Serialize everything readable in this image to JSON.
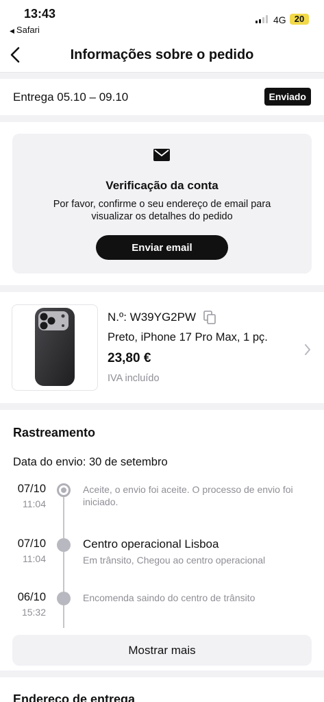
{
  "status_bar": {
    "time": "13:43",
    "back_app": "Safari",
    "network": "4G",
    "battery": "20"
  },
  "header": {
    "title": "Informações sobre o pedido"
  },
  "delivery": {
    "text": "Entrega 05.10 – 09.10",
    "status_badge": "Enviado"
  },
  "verification": {
    "icon": "mail-icon",
    "title": "Verificação da conta",
    "description": "Por favor, confirme o seu endereço de email para visualizar os detalhes do pedido",
    "button_label": "Enviar email"
  },
  "product": {
    "order_number": "N.º: W39YG2PW",
    "variant": "Preto, iPhone 17 Pro Max, 1 pç.",
    "price": "23,80 €",
    "tax_note": "IVA incluído"
  },
  "tracking": {
    "title": "Rastreamento",
    "ship_date": "Data do envio: 30 de setembro",
    "events": [
      {
        "date": "07/10",
        "time": "11:04",
        "title": "",
        "description": "Aceite, o envio foi aceite. O processo de envio foi iniciado."
      },
      {
        "date": "07/10",
        "time": "11:04",
        "title": "Centro operacional Lisboa",
        "description": "Em trânsito, Chegou ao centro operacional"
      },
      {
        "date": "06/10",
        "time": "15:32",
        "title": "",
        "description": "Encomenda saindo do centro de trânsito"
      }
    ],
    "more_button": "Mostrar mais"
  },
  "address": {
    "title": "Endereço de entrega"
  }
}
